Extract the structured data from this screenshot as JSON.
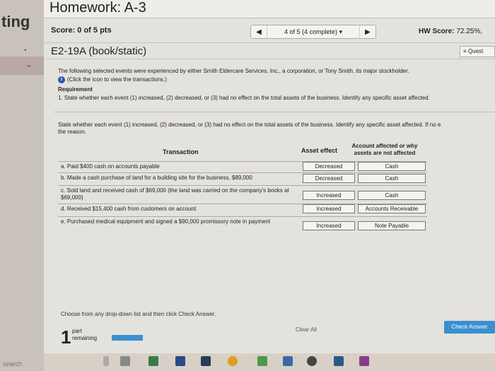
{
  "left_strip": {
    "text": "ting",
    "search_text": "search"
  },
  "header": {
    "title": "Homework: A-3"
  },
  "scorebar": {
    "score_label": "Score: 0 of 5 pts",
    "progress": "4 of 5 (4 complete)",
    "hw_label": "HW Score:",
    "hw_value": "72.25%,"
  },
  "question": {
    "title": "E2-19A (book/static)",
    "button_label": "Quest"
  },
  "intro": {
    "line1": "The following selected events were experienced by either Smith Eldercare Services, Inc., a corporation, or Tony Smith, its major stockholder.",
    "click_text": "(Click the icon to view the transactions.)",
    "requirement": "Requirement",
    "instruction": "1.   State whether each event (1) increased, (2) decreased, or (3) had no effect on the total assets of the business. Identify any specific asset affected."
  },
  "state_text": "State whether each event (1) increased, (2) decreased, or (3) had no effect on the total assets of the business. Identify any specific asset affected. If no e",
  "state_text2": "the reason.",
  "table": {
    "header_transaction": "Transaction",
    "header_asset_effect": "Asset effect",
    "header_account": "Account affected or why assets are not affected",
    "rows": [
      {
        "desc": "a. Paid $400 cash on accounts payable",
        "effect": "Decreased",
        "account": "Cash"
      },
      {
        "desc": "b. Made a cash purchase of land for a building site for the business, $89,000",
        "effect": "Decreased",
        "account": "Cash"
      },
      {
        "desc": "c. Sold land and received cash of $69,000 (the land was carried on the company's books at $69,000)",
        "effect": "Increased",
        "account": "Cash"
      },
      {
        "desc": "d. Received $15,400 cash from customers on account",
        "effect": "Increased",
        "account": "Accounts Receivable"
      },
      {
        "desc": "e. Purchased medical equipment and signed a $90,000 promissory note in payment",
        "effect": "Increased",
        "account": "Note Payable"
      }
    ]
  },
  "hint": "Choose from any drop-down list and then click Check Answer.",
  "footer": {
    "part_number": "1",
    "part_label_1": "part",
    "part_label_2": "remaining",
    "clear_label": "Clear All",
    "check_label": "Check Answer"
  },
  "colors": {
    "accent": "#3a8fd0",
    "info": "#2a5ca8"
  }
}
